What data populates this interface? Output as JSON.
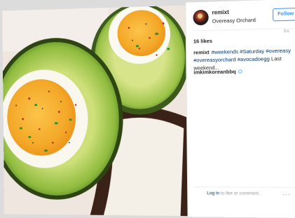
{
  "post": {
    "username": "remixt",
    "location": "Overeasy Orchard",
    "follow_label": "Follow",
    "age": "6w",
    "likes": "16 likes",
    "caption": {
      "username": "remixt",
      "parts": [
        {
          "text": "#weekends",
          "tag": true
        },
        {
          "text": " ",
          "tag": false
        },
        {
          "text": "#Saturday",
          "tag": true
        },
        {
          "text": " ",
          "tag": false
        },
        {
          "text": "#overeasy",
          "tag": true
        },
        {
          "text": " ",
          "tag": false
        },
        {
          "text": "#overeasyorchard",
          "tag": true
        },
        {
          "text": " ",
          "tag": false
        },
        {
          "text": "#avocadoegg",
          "tag": true
        },
        {
          "text": " Last weekend...",
          "tag": false
        }
      ]
    },
    "comment": {
      "username": "imkimkoreanbbq",
      "text": "O"
    },
    "login_link": "Log in",
    "login_rest": " to like or comment.",
    "more_label": "..."
  },
  "image": {
    "alt_subject": "baked egg in avocado",
    "colors": {
      "avocado": "#8ab83d",
      "yolk": "#f5b233",
      "plate": "#efe7df"
    }
  }
}
